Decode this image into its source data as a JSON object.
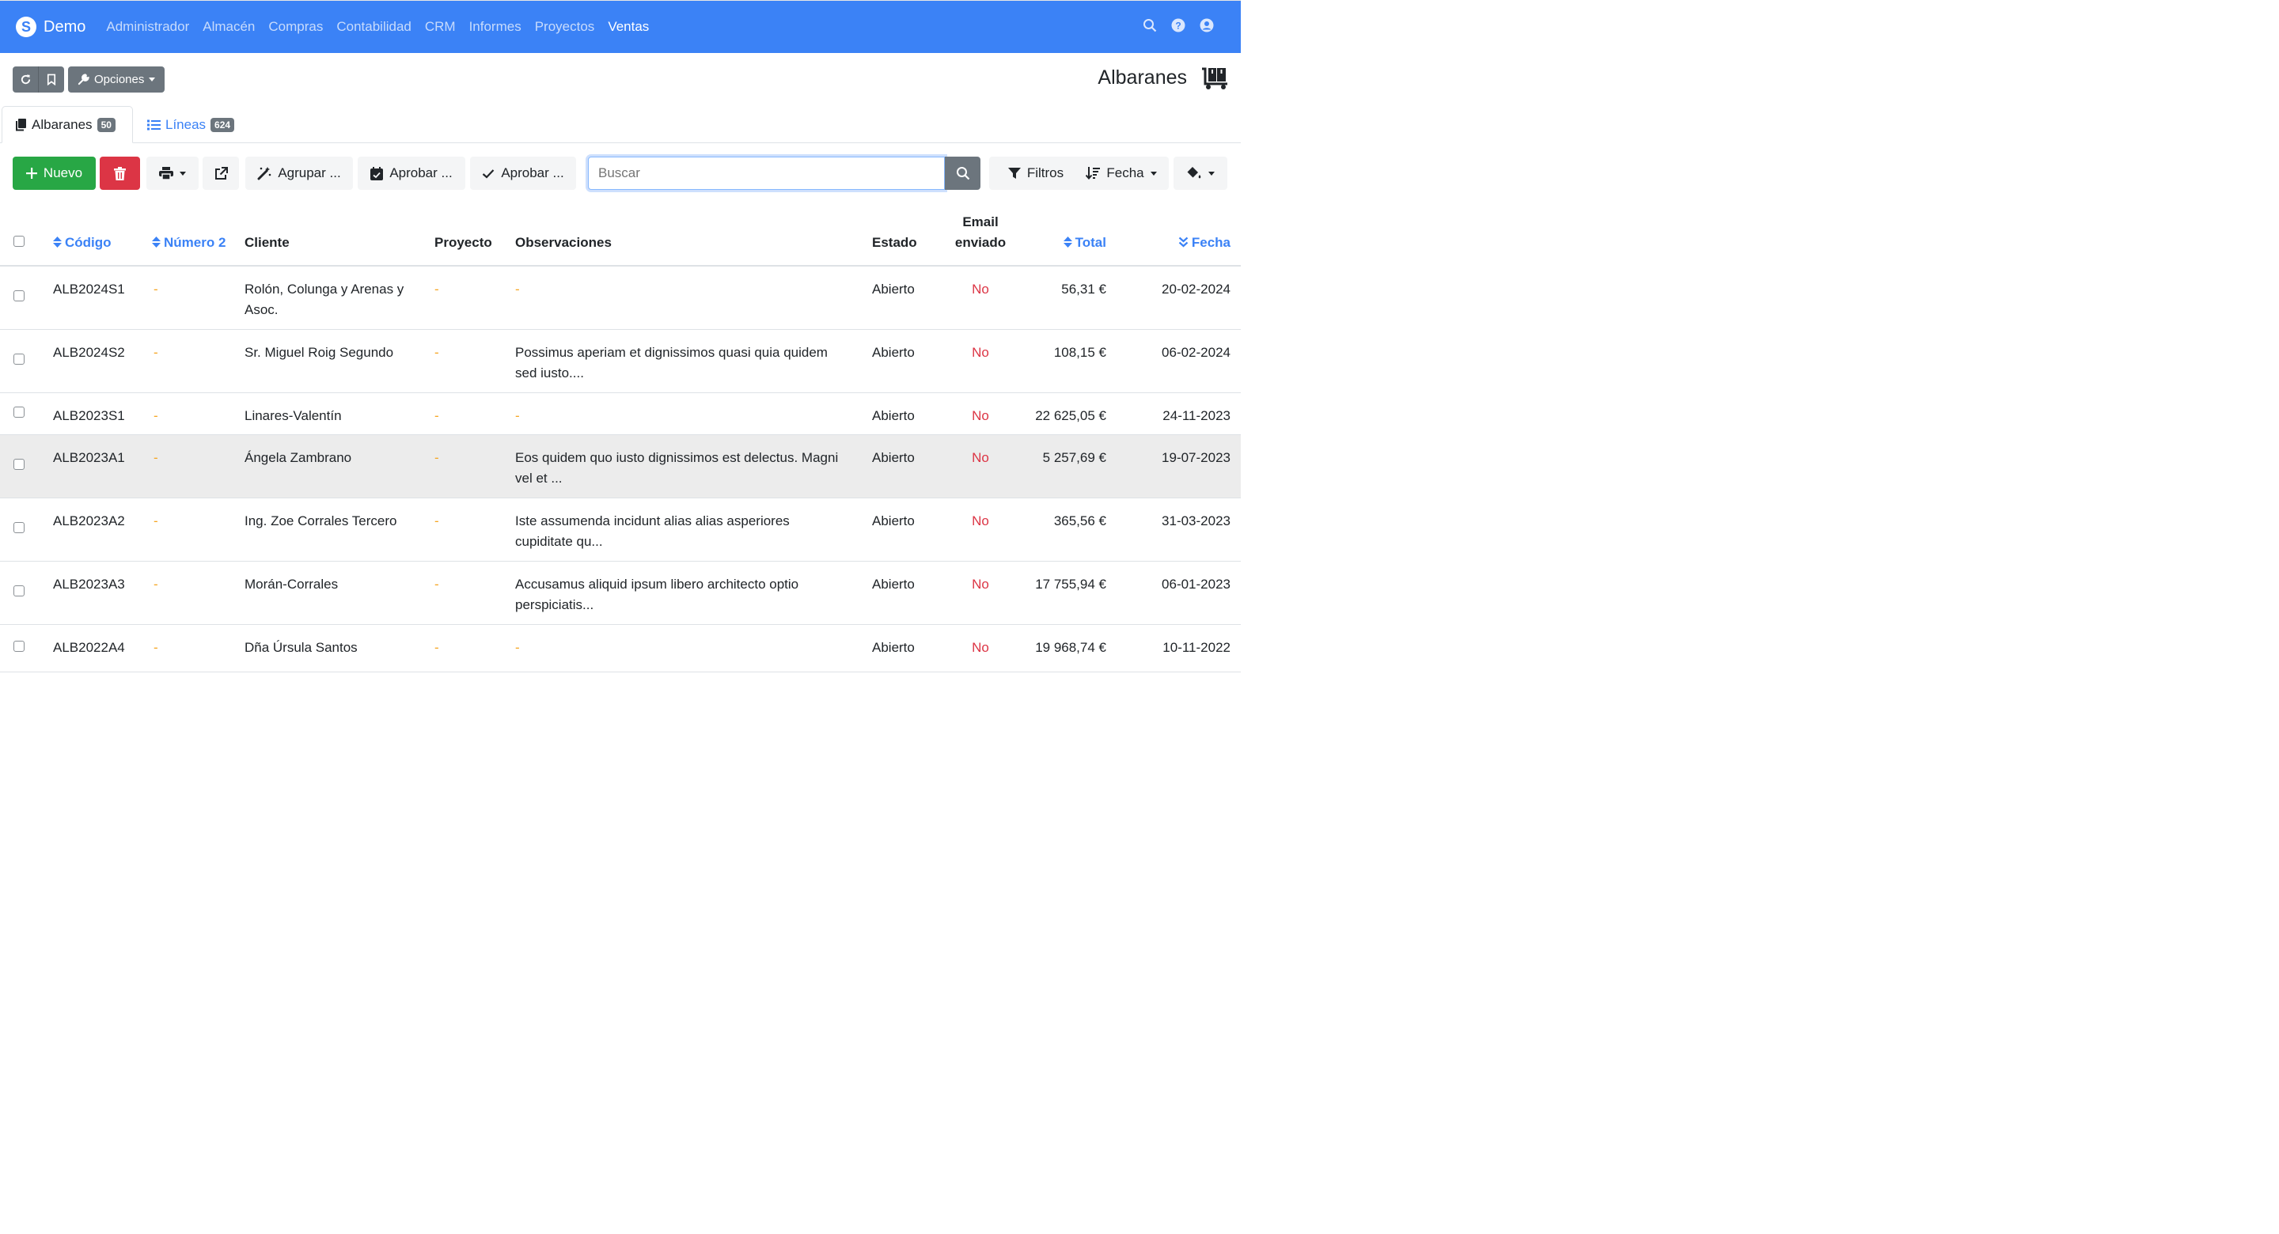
{
  "brand": {
    "name": "Demo"
  },
  "nav": {
    "items": [
      "Administrador",
      "Almacén",
      "Compras",
      "Contabilidad",
      "CRM",
      "Informes",
      "Proyectos",
      "Ventas"
    ],
    "active": "Ventas"
  },
  "toolbar": {
    "options_label": "Opciones"
  },
  "page": {
    "title": "Albaranes"
  },
  "tabs": [
    {
      "label": "Albaranes",
      "count": "50"
    },
    {
      "label": "Líneas",
      "count": "624"
    }
  ],
  "actions": {
    "new_label": "Nuevo",
    "group_label": "Agrupar ...",
    "approve1_label": "Aprobar ...",
    "approve2_label": "Aprobar ...",
    "search_placeholder": "Buscar",
    "filters_label": "Filtros",
    "sort_label": "Fecha"
  },
  "table": {
    "headers": {
      "codigo": "Código",
      "numero": "Número 2",
      "cliente": "Cliente",
      "proyecto": "Proyecto",
      "observaciones": "Observaciones",
      "estado": "Estado",
      "email": "Email enviado",
      "total": "Total",
      "fecha": "Fecha"
    },
    "rows": [
      {
        "codigo": "ALB2024S1",
        "numero": "-",
        "cliente": "Rolón, Colunga y Arenas y Asoc.",
        "proyecto": "-",
        "observaciones": "-",
        "estado": "Abierto",
        "email": "No",
        "total": "56,31 €",
        "fecha": "20-02-2024"
      },
      {
        "codigo": "ALB2024S2",
        "numero": "-",
        "cliente": "Sr. Miguel Roig Segundo",
        "proyecto": "-",
        "observaciones": "Possimus aperiam et dignissimos quasi quia quidem sed iusto....",
        "estado": "Abierto",
        "email": "No",
        "total": "108,15 €",
        "fecha": "06-02-2024"
      },
      {
        "codigo": "ALB2023S1",
        "numero": "-",
        "cliente": "Linares-Valentín",
        "proyecto": "-",
        "observaciones": "-",
        "estado": "Abierto",
        "email": "No",
        "total": "22 625,05 €",
        "fecha": "24-11-2023"
      },
      {
        "codigo": "ALB2023A1",
        "numero": "-",
        "cliente": "Ángela Zambrano",
        "proyecto": "-",
        "observaciones": "Eos quidem quo iusto dignissimos est delectus. Magni vel et ...",
        "estado": "Abierto",
        "email": "No",
        "total": "5 257,69 €",
        "fecha": "19-07-2023"
      },
      {
        "codigo": "ALB2023A2",
        "numero": "-",
        "cliente": "Ing. Zoe Corrales Tercero",
        "proyecto": "-",
        "observaciones": "Iste assumenda incidunt alias alias asperiores cupiditate qu...",
        "estado": "Abierto",
        "email": "No",
        "total": "365,56 €",
        "fecha": "31-03-2023"
      },
      {
        "codigo": "ALB2023A3",
        "numero": "-",
        "cliente": "Morán-Corrales",
        "proyecto": "-",
        "observaciones": "Accusamus aliquid ipsum libero architecto optio perspiciatis...",
        "estado": "Abierto",
        "email": "No",
        "total": "17 755,94 €",
        "fecha": "06-01-2023"
      },
      {
        "codigo": "ALB2022A4",
        "numero": "-",
        "cliente": "Dña Úrsula Santos",
        "proyecto": "-",
        "observaciones": "-",
        "estado": "Abierto",
        "email": "No",
        "total": "19 968,74 €",
        "fecha": "10-11-2022"
      }
    ]
  },
  "icons": {
    "logo": "brand-logo-icon",
    "search": "search-icon",
    "help": "question-circle-icon",
    "user": "user-circle-icon",
    "refresh": "refresh-icon",
    "bookmark": "bookmark-icon",
    "wrench": "wrench-icon",
    "dolly": "dolly-flatbed-icon",
    "copy": "copy-icon",
    "list": "list-icon",
    "plus": "plus-icon",
    "trash": "trash-icon",
    "print": "print-icon",
    "external": "external-link-icon",
    "magic": "magic-wand-icon",
    "calendar": "calendar-check-icon",
    "check": "check-icon",
    "filter": "filter-icon",
    "sort": "sort-amount-icon",
    "paint": "paint-bucket-icon"
  },
  "colors": {
    "primary": "#3b82f6",
    "success": "#28a745",
    "danger": "#dc3545",
    "secondary": "#6c757d",
    "dash": "#f5a623"
  }
}
